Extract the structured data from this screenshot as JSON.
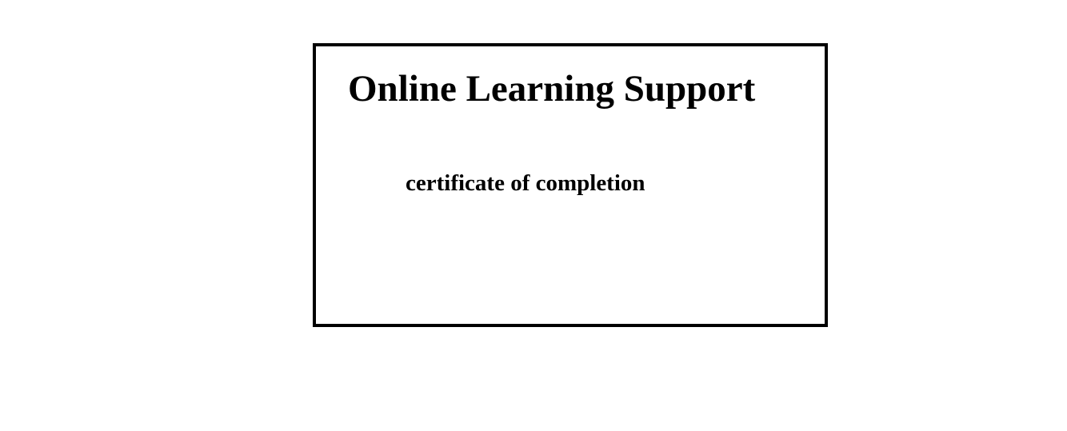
{
  "certificate": {
    "title": "Online Learning Support",
    "subtitle": "certificate of completion",
    "border_color": "#000000",
    "background_color": "#ffffff"
  }
}
